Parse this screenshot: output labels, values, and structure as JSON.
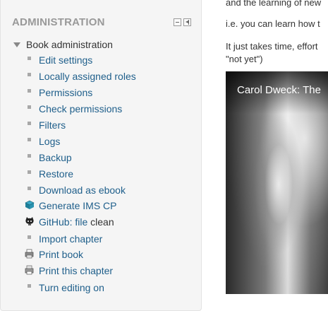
{
  "admin_block": {
    "title": "ADMINISTRATION",
    "hide_control": "hide-icon",
    "dock_control": "dock-icon",
    "section_label": "Book administration",
    "items": [
      {
        "label": "Edit settings",
        "icon": "bullet"
      },
      {
        "label": "Locally assigned roles",
        "icon": "bullet"
      },
      {
        "label": "Permissions",
        "icon": "bullet"
      },
      {
        "label": "Check permissions",
        "icon": "bullet"
      },
      {
        "label": "Filters",
        "icon": "bullet"
      },
      {
        "label": "Logs",
        "icon": "bullet"
      },
      {
        "label": "Backup",
        "icon": "bullet"
      },
      {
        "label": "Restore",
        "icon": "bullet"
      },
      {
        "label": "Download as ebook",
        "icon": "bullet"
      },
      {
        "label": "Generate IMS CP",
        "icon": "ims-cp-icon"
      },
      {
        "label": "GitHub: file",
        "label_suffix": "clean",
        "icon": "github-icon"
      },
      {
        "label": "Import chapter",
        "icon": "bullet"
      },
      {
        "label": "Print book",
        "icon": "print-book-icon"
      },
      {
        "label": "Print this chapter",
        "icon": "print-chapter-icon"
      },
      {
        "label": "Turn editing on",
        "icon": "bullet"
      }
    ]
  },
  "content": {
    "line1": "and the learning of new",
    "line2": "i.e. you can learn how t",
    "line3a": "It just takes time, effort",
    "line3b": "\"not yet\")",
    "video_title": "Carol Dweck: The"
  },
  "colors": {
    "link": "#1f5f8b",
    "block_bg": "#f5f5f5",
    "title": "#999999"
  }
}
